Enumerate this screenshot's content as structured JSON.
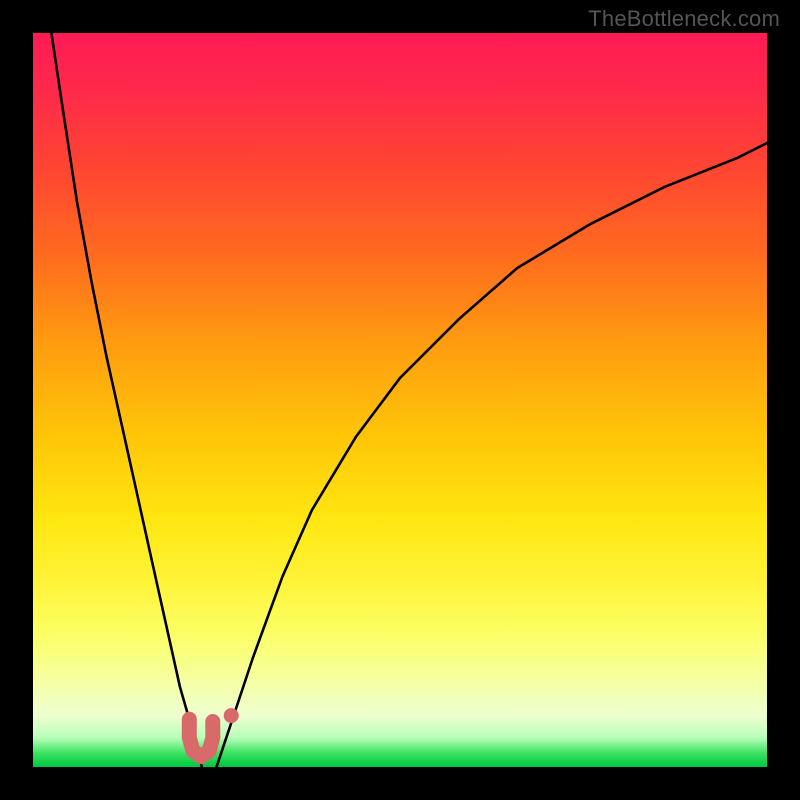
{
  "watermark": "TheBottleneck.com",
  "colors": {
    "frame": "#000000",
    "curve": "#000000",
    "marker": "#d86a6a",
    "gradient_stops": [
      "#ff1a55",
      "#ff2a4a",
      "#ff4433",
      "#ff6a1f",
      "#ff9b10",
      "#ffc608",
      "#ffe610",
      "#fff43a",
      "#fbff66",
      "#f6ffa0",
      "#eeffd0",
      "#b8ffb8",
      "#38e060",
      "#00c840"
    ]
  },
  "chart_data": {
    "type": "line",
    "title": "",
    "xlabel": "",
    "ylabel": "",
    "xlim": [
      0,
      100
    ],
    "ylim": [
      0,
      100
    ],
    "series": [
      {
        "name": "left-curve",
        "x": [
          2.5,
          4,
          6,
          8,
          10,
          12,
          14,
          16,
          18,
          20,
          22,
          23
        ],
        "y": [
          100,
          90,
          77,
          66,
          56,
          47,
          38,
          29,
          20,
          11,
          4,
          0
        ]
      },
      {
        "name": "right-curve",
        "x": [
          25,
          27,
          30,
          34,
          38,
          44,
          50,
          58,
          66,
          76,
          86,
          96,
          100
        ],
        "y": [
          0,
          6,
          15,
          26,
          35,
          45,
          53,
          61,
          68,
          74,
          79,
          83,
          85
        ]
      }
    ],
    "markers": {
      "name": "bottom-U",
      "points": [
        {
          "x": 21.3,
          "y": 6.5
        },
        {
          "x": 21.3,
          "y": 4.0
        },
        {
          "x": 21.8,
          "y": 2.2
        },
        {
          "x": 22.9,
          "y": 1.4
        },
        {
          "x": 24.0,
          "y": 2.2
        },
        {
          "x": 24.5,
          "y": 4.0
        },
        {
          "x": 24.5,
          "y": 6.2
        }
      ],
      "extra_dot": {
        "x": 27.0,
        "y": 7.0
      }
    }
  }
}
